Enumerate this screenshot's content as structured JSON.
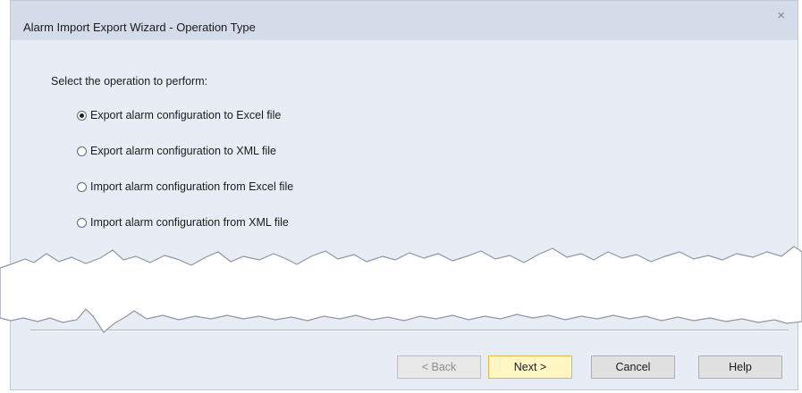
{
  "window": {
    "title": "Alarm Import Export Wizard - Operation Type",
    "close_glyph": "×"
  },
  "prompt": "Select the operation to perform:",
  "options": [
    {
      "label": "Export alarm configuration to Excel file",
      "selected": true
    },
    {
      "label": "Export alarm configuration to XML file",
      "selected": false
    },
    {
      "label": "Import alarm configuration from Excel file",
      "selected": false
    },
    {
      "label": "Import alarm configuration from XML file",
      "selected": false
    }
  ],
  "buttons": {
    "back": "< Back",
    "next": "Next >",
    "cancel": "Cancel",
    "help": "Help"
  },
  "colors": {
    "dialog_bg": "#e8edf5",
    "titlebar_bg": "#d4dcea",
    "default_button_bg": "#fff6c4"
  }
}
